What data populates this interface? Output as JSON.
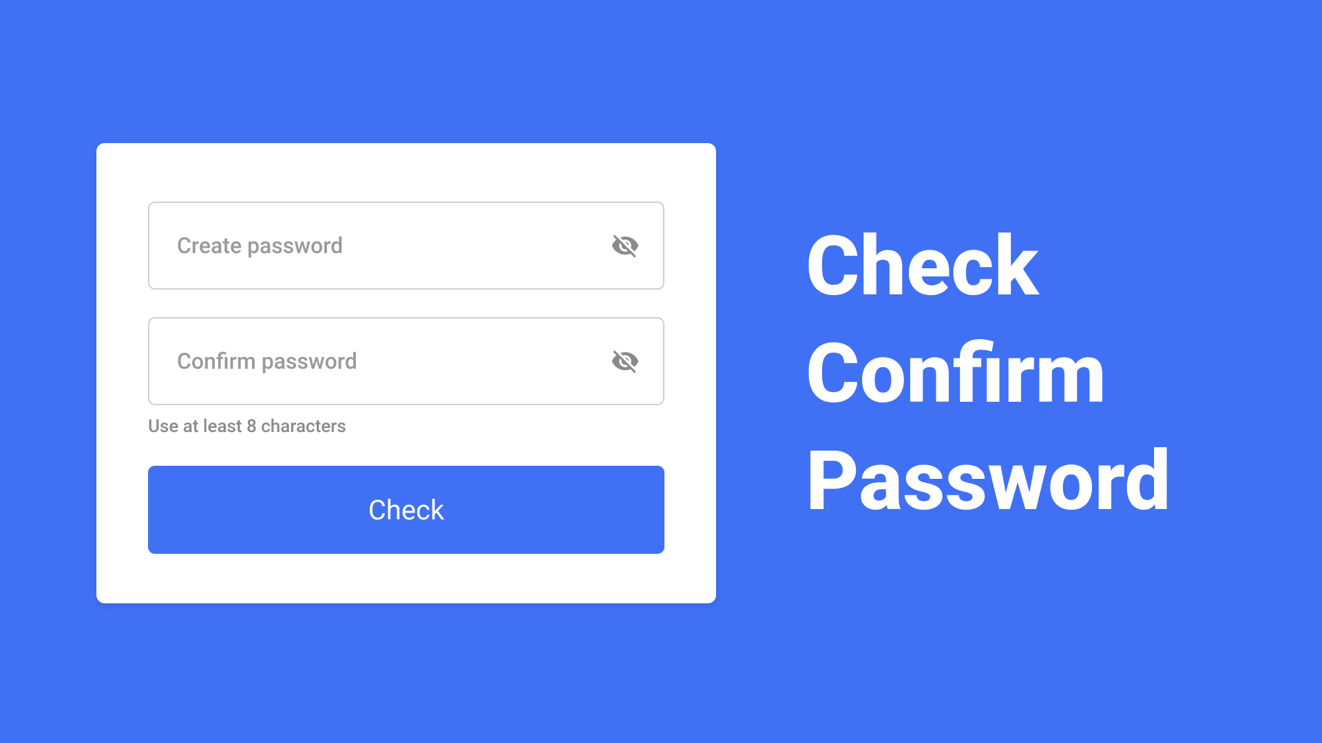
{
  "form": {
    "create_password_placeholder": "Create password",
    "confirm_password_placeholder": "Confirm password",
    "hint": "Use at least 8 characters",
    "button_label": "Check"
  },
  "heading": {
    "line1": "Check",
    "line2": "Confirm",
    "line3": "Password"
  },
  "colors": {
    "background": "#4070F4",
    "card": "#ffffff",
    "border": "#d0d0d0",
    "placeholder": "#9a9a9a",
    "icon": "#8a8a8a",
    "button": "#4070F4"
  }
}
